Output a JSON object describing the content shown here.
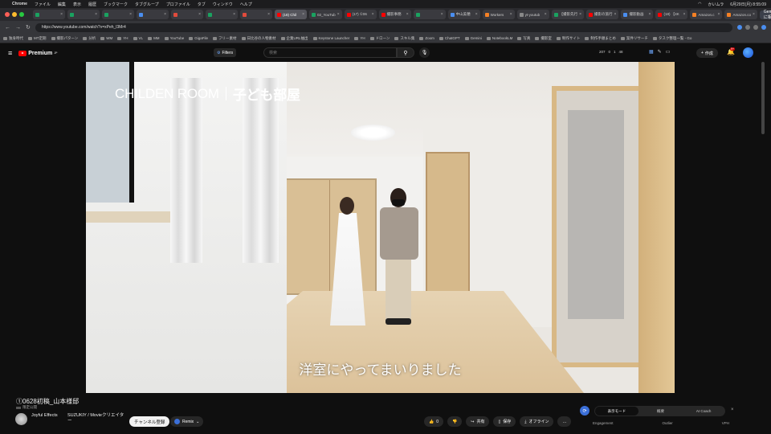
{
  "menubar": {
    "apple": "",
    "items": [
      "Chrome",
      "ファイル",
      "編集",
      "表示",
      "履歴",
      "ブックマーク",
      "タブグループ",
      "プロファイル",
      "タブ",
      "ウィンドウ",
      "ヘルプ"
    ],
    "datetime": "6月29日(月) 8:55:09",
    "user": "かいムラ"
  },
  "tabs": [
    {
      "label": "",
      "color": "#1aa260"
    },
    {
      "label": "",
      "color": "#1aa260"
    },
    {
      "label": "",
      "color": "#1aa260"
    },
    {
      "label": "",
      "color": "#4a8ef0"
    },
    {
      "label": "",
      "color": "#e04b3c"
    },
    {
      "label": "",
      "color": "#1aa260"
    },
    {
      "label": "",
      "color": "#e04b3c"
    },
    {
      "label": "(18) Chil",
      "color": "#ff0000",
      "active": true
    },
    {
      "label": "02_YouTub",
      "color": "#1aa260"
    },
    {
      "label": "(17) ①06",
      "color": "#ff0000"
    },
    {
      "label": "撮影事務",
      "color": "#ff0000"
    },
    {
      "label": "",
      "color": "#1aa260"
    },
    {
      "label": "中山美穂",
      "color": "#4a8ef0"
    },
    {
      "label": "Workers",
      "color": "#f48024"
    },
    {
      "label": "yt-youtub",
      "color": "#888888"
    },
    {
      "label": "【撮影先行",
      "color": "#1aa260"
    },
    {
      "label": "撮影の旅行",
      "color": "#ff0000"
    },
    {
      "label": "撮影動画",
      "color": "#4a8ef0"
    },
    {
      "label": "(18) 【4K",
      "color": "#ff0000"
    },
    {
      "label": "Amazon.c",
      "color": "#f48024"
    },
    {
      "label": "Amazon.co",
      "color": "#f48024"
    }
  ],
  "gemini_button": "Gemini に相談",
  "url": "https://www.youtube.com/watch?v=xPeh_l3Mr4",
  "bookmarks": [
    "独身時代",
    "MT定期",
    "撮影パターン",
    "分析",
    "WM",
    "YH",
    "VL",
    "MM",
    "YouTube",
    "GigaFile",
    "フリー素材",
    "日比谷の人物素材",
    "企業URL抽出",
    "Keystone Launcher",
    "YH",
    "ドローン",
    "スキル集",
    "Zoom",
    "ChatGPT",
    "Gemini",
    "NotebookLM",
    "写真",
    "撮影室",
    "制作サイト",
    "制作手順まとめ",
    "案件リサーチ",
    "タスク整理一覧 - Go"
  ],
  "yt": {
    "logo": "Premium",
    "logo_suffix": "JP",
    "filters": "Filters",
    "search_placeholder": "検索",
    "stats": [
      "207",
      "0",
      "1",
      "48"
    ],
    "create": "作成",
    "notifications": "9+"
  },
  "video": {
    "overlay_title_en": "CHILDEN ROOM",
    "overlay_title_ja": "子ども部屋",
    "subtitle": "洋室にやってまいりました",
    "title": "①0628初稿_山本様邸",
    "visibility": "限定公開"
  },
  "channel": {
    "name": "Joyful Effects",
    "desc": "SUZUKIY / Movieクリエイター",
    "subscribe": "チャンネル登録",
    "remix": "Remix"
  },
  "actions": [
    {
      "name": "like",
      "icon": "thumbs-up-icon",
      "label": "0"
    },
    {
      "name": "dislike",
      "icon": "thumbs-down-icon",
      "label": ""
    },
    {
      "name": "share",
      "icon": "share-icon",
      "label": "共有"
    },
    {
      "name": "save",
      "icon": "bookmark-icon",
      "label": "保存"
    },
    {
      "name": "offline",
      "icon": "download-icon",
      "label": "オフライン"
    },
    {
      "name": "more",
      "icon": "more-icon",
      "label": "…"
    }
  ],
  "panel": {
    "segments": [
      "表示モード",
      "概要",
      "AI Coach"
    ],
    "labels": [
      "Engagement",
      "Outlier",
      "VPH"
    ]
  }
}
